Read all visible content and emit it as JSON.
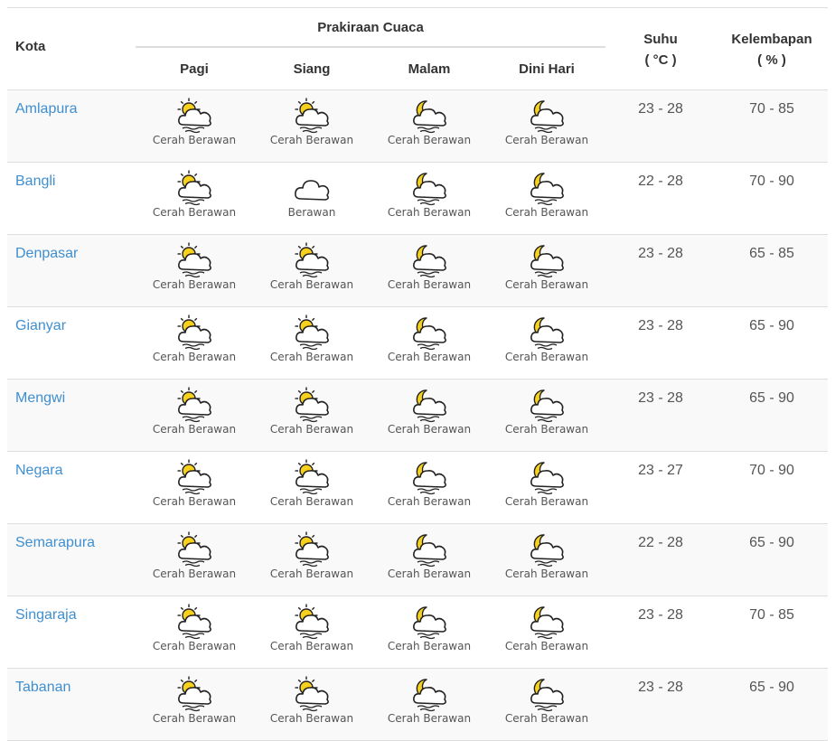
{
  "header": {
    "kota": "Kota",
    "prakiraan": "Prakiraan Cuaca",
    "periods": [
      "Pagi",
      "Siang",
      "Malam",
      "Dini Hari"
    ],
    "suhu_line1": "Suhu",
    "suhu_line2": "( °C )",
    "kelembapan_line1": "Kelembapan",
    "kelembapan_line2": "( % )"
  },
  "rows": [
    {
      "city": "Amlapura",
      "pagi": {
        "icon": "sun-cloud-icon",
        "label": "Cerah Berawan"
      },
      "siang": {
        "icon": "sun-cloud-icon",
        "label": "Cerah Berawan"
      },
      "malam": {
        "icon": "moon-cloud-icon",
        "label": "Cerah Berawan"
      },
      "dini": {
        "icon": "moon-cloud-icon",
        "label": "Cerah Berawan"
      },
      "suhu": "23 - 28",
      "kelembapan": "70 - 85"
    },
    {
      "city": "Bangli",
      "pagi": {
        "icon": "sun-cloud-icon",
        "label": "Cerah Berawan"
      },
      "siang": {
        "icon": "cloud-icon",
        "label": "Berawan"
      },
      "malam": {
        "icon": "moon-cloud-icon",
        "label": "Cerah Berawan"
      },
      "dini": {
        "icon": "moon-cloud-icon",
        "label": "Cerah Berawan"
      },
      "suhu": "22 - 28",
      "kelembapan": "70 - 90"
    },
    {
      "city": "Denpasar",
      "pagi": {
        "icon": "sun-cloud-icon",
        "label": "Cerah Berawan"
      },
      "siang": {
        "icon": "sun-cloud-icon",
        "label": "Cerah Berawan"
      },
      "malam": {
        "icon": "moon-cloud-icon",
        "label": "Cerah Berawan"
      },
      "dini": {
        "icon": "moon-cloud-icon",
        "label": "Cerah Berawan"
      },
      "suhu": "23 - 28",
      "kelembapan": "65 - 85"
    },
    {
      "city": "Gianyar",
      "pagi": {
        "icon": "sun-cloud-icon",
        "label": "Cerah Berawan"
      },
      "siang": {
        "icon": "sun-cloud-icon",
        "label": "Cerah Berawan"
      },
      "malam": {
        "icon": "moon-cloud-icon",
        "label": "Cerah Berawan"
      },
      "dini": {
        "icon": "moon-cloud-icon",
        "label": "Cerah Berawan"
      },
      "suhu": "23 - 28",
      "kelembapan": "65 - 90"
    },
    {
      "city": "Mengwi",
      "pagi": {
        "icon": "sun-cloud-icon",
        "label": "Cerah Berawan"
      },
      "siang": {
        "icon": "sun-cloud-icon",
        "label": "Cerah Berawan"
      },
      "malam": {
        "icon": "moon-cloud-icon",
        "label": "Cerah Berawan"
      },
      "dini": {
        "icon": "moon-cloud-icon",
        "label": "Cerah Berawan"
      },
      "suhu": "23 - 28",
      "kelembapan": "65 - 90"
    },
    {
      "city": "Negara",
      "pagi": {
        "icon": "sun-cloud-icon",
        "label": "Cerah Berawan"
      },
      "siang": {
        "icon": "sun-cloud-icon",
        "label": "Cerah Berawan"
      },
      "malam": {
        "icon": "moon-cloud-icon",
        "label": "Cerah Berawan"
      },
      "dini": {
        "icon": "moon-cloud-icon",
        "label": "Cerah Berawan"
      },
      "suhu": "23 - 27",
      "kelembapan": "70 - 90"
    },
    {
      "city": "Semarapura",
      "pagi": {
        "icon": "sun-cloud-icon",
        "label": "Cerah Berawan"
      },
      "siang": {
        "icon": "sun-cloud-icon",
        "label": "Cerah Berawan"
      },
      "malam": {
        "icon": "moon-cloud-icon",
        "label": "Cerah Berawan"
      },
      "dini": {
        "icon": "moon-cloud-icon",
        "label": "Cerah Berawan"
      },
      "suhu": "22 - 28",
      "kelembapan": "65 - 90"
    },
    {
      "city": "Singaraja",
      "pagi": {
        "icon": "sun-cloud-icon",
        "label": "Cerah Berawan"
      },
      "siang": {
        "icon": "sun-cloud-icon",
        "label": "Cerah Berawan"
      },
      "malam": {
        "icon": "moon-cloud-icon",
        "label": "Cerah Berawan"
      },
      "dini": {
        "icon": "moon-cloud-icon",
        "label": "Cerah Berawan"
      },
      "suhu": "23 - 28",
      "kelembapan": "70 - 85"
    },
    {
      "city": "Tabanan",
      "pagi": {
        "icon": "sun-cloud-icon",
        "label": "Cerah Berawan"
      },
      "siang": {
        "icon": "sun-cloud-icon",
        "label": "Cerah Berawan"
      },
      "malam": {
        "icon": "moon-cloud-icon",
        "label": "Cerah Berawan"
      },
      "dini": {
        "icon": "moon-cloud-icon",
        "label": "Cerah Berawan"
      },
      "suhu": "23 - 28",
      "kelembapan": "65 - 90"
    }
  ],
  "colors": {
    "link": "#3f8fd0",
    "sun": "#f7d11e",
    "border": "#dddddd",
    "alt_row": "#f9f9f9"
  }
}
